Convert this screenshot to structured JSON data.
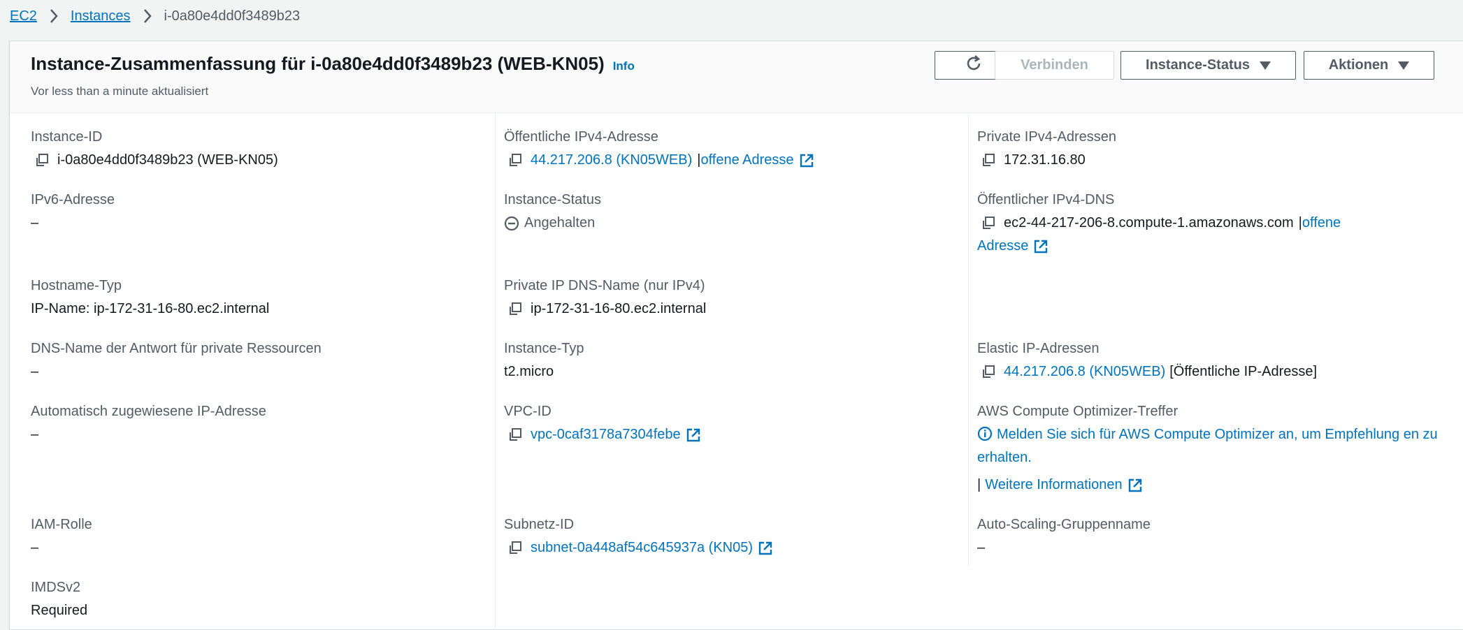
{
  "breadcrumb": {
    "items": [
      "EC2",
      "Instances"
    ],
    "current": "i-0a80e4dd0f3489b23"
  },
  "header": {
    "title": "Instance-Zusammenfassung für i-0a80e4dd0f3489b23 (WEB-KN05)",
    "info": "Info",
    "subtitle": "Vor less than a minute aktualisiert",
    "buttons": {
      "connect": "Verbinden",
      "instance_status": "Instance-Status",
      "actions": "Aktionen"
    }
  },
  "fields": {
    "instance_id": {
      "label": "Instance-ID",
      "value": "i-0a80e4dd0f3489b23 (WEB-KN05)"
    },
    "ipv6": {
      "label": "IPv6-Adresse",
      "value": "–"
    },
    "hostname_type": {
      "label": "Hostname-Typ",
      "value": "IP-Name: ip-172-31-16-80.ec2.internal"
    },
    "dns_private_resources": {
      "label": "DNS-Name der Antwort für private Ressourcen",
      "value": "–"
    },
    "auto_ip": {
      "label": "Automatisch zugewiesene IP-Adresse",
      "value": "–"
    },
    "iam_role": {
      "label": "IAM-Rolle",
      "value": "–"
    },
    "imdsv2": {
      "label": "IMDSv2",
      "value": "Required"
    },
    "public_ipv4": {
      "label": "Öffentliche IPv4-Adresse",
      "value": "44.217.206.8 (KN05WEB)",
      "sep": "|",
      "link": "offene Adresse"
    },
    "instance_state": {
      "label": "Instance-Status",
      "value": "Angehalten"
    },
    "private_ip_dns": {
      "label": "Private IP DNS-Name (nur IPv4)",
      "value": "ip-172-31-16-80.ec2.internal"
    },
    "instance_type": {
      "label": "Instance-Typ",
      "value": "t2.micro"
    },
    "vpc_id": {
      "label": "VPC-ID",
      "value": "vpc-0caf3178a7304febe"
    },
    "subnet_id": {
      "label": "Subnetz-ID",
      "value": "subnet-0a448af54c645937a (KN05)"
    },
    "private_ipv4": {
      "label": "Private IPv4-Adressen",
      "value": "172.31.16.80"
    },
    "public_dns": {
      "label": "Öffentlicher IPv4-DNS",
      "value": "ec2-44-217-206-8.compute-1.amazonaws.com",
      "sep": "|",
      "link_line1": "offene",
      "link_line2": "Adresse"
    },
    "elastic_ip": {
      "label": "Elastic IP-Adressen",
      "value": "44.217.206.8 (KN05WEB)",
      "suffix": "[Öffentliche IP-Adresse]"
    },
    "optimizer": {
      "label": "AWS Compute Optimizer-Treffer",
      "value": "Melden Sie sich für AWS Compute Optimizer an, um Empfehlung en zu erhalten.",
      "sep": "|",
      "more": "Weitere Informationen"
    },
    "asg_name": {
      "label": "Auto-Scaling-Gruppenname",
      "value": "–"
    }
  },
  "colors": {
    "link": "#0073bb",
    "label": "#545b64",
    "text": "#16191f"
  }
}
